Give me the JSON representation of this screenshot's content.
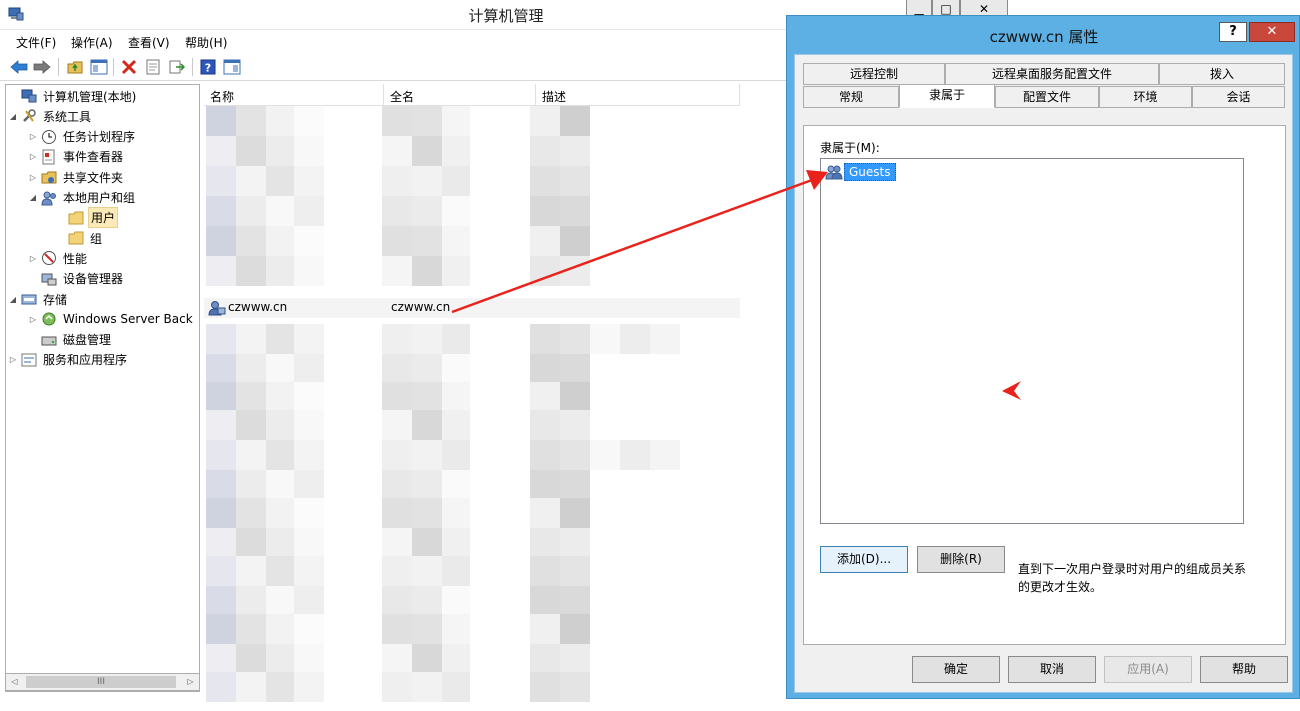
{
  "main_window": {
    "title": "计算机管理",
    "menu": [
      "文件(F)",
      "操作(A)",
      "查看(V)",
      "帮助(H)"
    ],
    "tree": [
      {
        "label": "计算机管理(本地)",
        "level": 0,
        "arrow": "",
        "icon": "computer-management-icon"
      },
      {
        "label": "系统工具",
        "level": 0,
        "arrow": "▲",
        "icon": "tools-icon"
      },
      {
        "label": "任务计划程序",
        "level": 1,
        "arrow": "▷",
        "icon": "clock-icon"
      },
      {
        "label": "事件查看器",
        "level": 1,
        "arrow": "▷",
        "icon": "event-viewer-icon"
      },
      {
        "label": "共享文件夹",
        "level": 1,
        "arrow": "▷",
        "icon": "shared-folder-icon"
      },
      {
        "label": "本地用户和组",
        "level": 1,
        "arrow": "▲",
        "icon": "users-groups-icon"
      },
      {
        "label": "用户",
        "level": 2,
        "arrow": "",
        "icon": "folder-icon",
        "selected": true
      },
      {
        "label": "组",
        "level": 2,
        "arrow": "",
        "icon": "folder-icon"
      },
      {
        "label": "性能",
        "level": 1,
        "arrow": "▷",
        "icon": "performance-icon"
      },
      {
        "label": "设备管理器",
        "level": 1,
        "arrow": "",
        "icon": "device-manager-icon"
      },
      {
        "label": "存储",
        "level": 0,
        "arrow": "▲",
        "icon": "storage-icon"
      },
      {
        "label": "Windows Server Back",
        "level": 1,
        "arrow": "▷",
        "icon": "backup-icon"
      },
      {
        "label": "磁盘管理",
        "level": 1,
        "arrow": "",
        "icon": "disk-icon"
      },
      {
        "label": "服务和应用程序",
        "level": 0,
        "arrow": "▷",
        "icon": "services-icon"
      }
    ],
    "scroll_label": "III",
    "columns": [
      "名称",
      "全名",
      "描述"
    ],
    "user_row": {
      "name": "czwww.cn",
      "fullname": "czwww.cn"
    }
  },
  "dialog": {
    "title": "czwww.cn 属性",
    "help_label": "?",
    "close_label": "✕",
    "tabs_row1": [
      "远程控制",
      "远程桌面服务配置文件",
      "拨入"
    ],
    "tabs_row2": [
      "常规",
      "隶属于",
      "配置文件",
      "环境",
      "会话"
    ],
    "active_tab": "隶属于",
    "member_label": "隶属于(M):",
    "members": [
      "Guests"
    ],
    "add_button": "添加(D)...",
    "remove_button": "删除(R)",
    "note": "直到下一次用户登录时对用户的组成员关系的更改才生效。",
    "ok_button": "确定",
    "cancel_button": "取消",
    "apply_button": "应用(A)",
    "help_button": "帮助"
  },
  "colors": {
    "dialog_frame": "#5db0e3",
    "selection": "#3399ff",
    "arrow": "#e8231b"
  }
}
